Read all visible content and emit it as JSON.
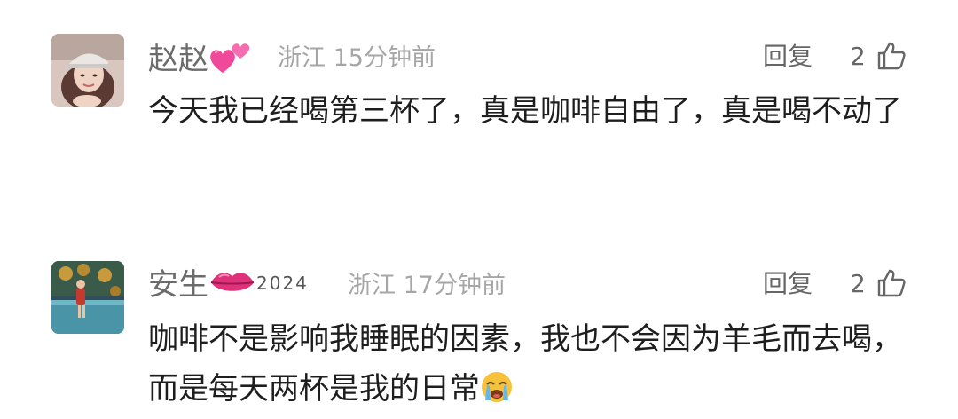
{
  "comments": [
    {
      "username": "赵赵",
      "name_emoji": "two-hearts",
      "location": "浙江",
      "time": "15分钟前",
      "reply_label": "回复",
      "likes": "2",
      "text": "今天我已经喝第三杯了，真是咖啡自由了，真是喝不动了"
    },
    {
      "username": "安生",
      "name_emoji": "lips",
      "badge": "2024",
      "location": "浙江",
      "time": "17分钟前",
      "reply_label": "回复",
      "likes": "2",
      "text": "咖啡不是影响我睡眠的因素，我也不会因为羊毛而去喝，而是每天两杯是我的日常",
      "text_emoji": "loudly-crying-face"
    }
  ]
}
